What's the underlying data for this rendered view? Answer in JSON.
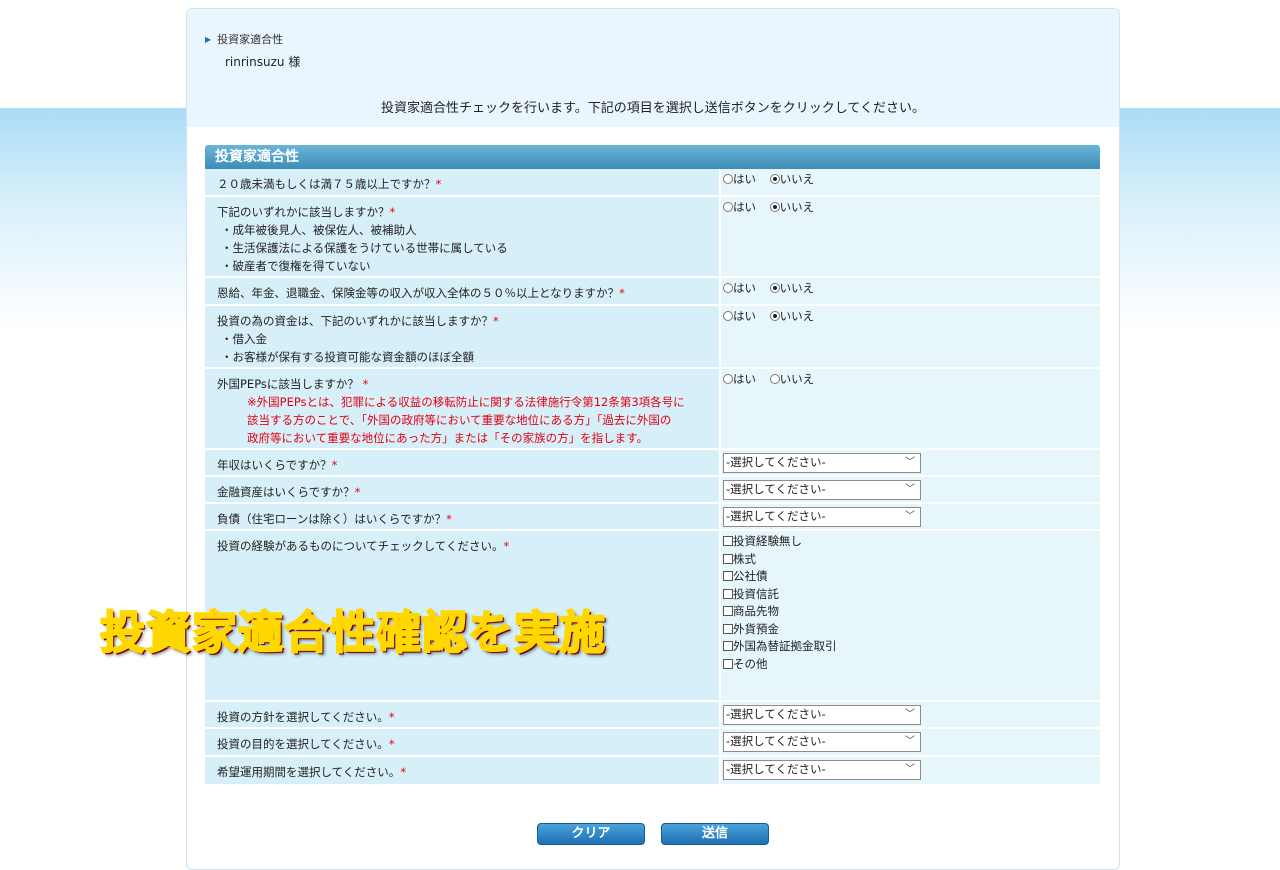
{
  "breadcrumb": "投資家適合性",
  "user": {
    "name": "rinrinsuzu",
    "suffix": "様"
  },
  "instruction": "投資家適合性チェックを行います。下記の項目を選択し送信ボタンをクリックしてください。",
  "form_title": "投資家適合性",
  "required_mark": "*",
  "radio_labels": {
    "yes": "はい",
    "no": "いいえ"
  },
  "q": {
    "age": {
      "label": "２０歳未満もしくは満７５歳以上ですか？",
      "selected": "いいえ"
    },
    "status": {
      "label": "下記のいずれかに該当しますか？",
      "items": [
        "・成年被後見人、被保佐人、被補助人",
        "・生活保護法による保護をうけている世帯に属している",
        "・破産者で復権を得ていない"
      ],
      "selected": "いいえ"
    },
    "pension": {
      "label": "恩給、年金、退職金、保険金等の収入が収入全体の５０％以上となりますか？",
      "selected": "いいえ"
    },
    "funds": {
      "label": "投資の為の資金は、下記のいずれかに該当しますか？",
      "items": [
        "・借入金",
        "・お客様が保有する投資可能な資金額のほぼ全額"
      ],
      "selected": "いいえ"
    },
    "peps": {
      "label": "外国PEPsに該当しますか？",
      "notes": [
        "※外国PEPsとは、犯罪による収益の移転防止に関する法律施行令第12条第3項各号に",
        "該当する方のことで、「外国の政府等において重要な地位にある方」「過去に外国の",
        "政府等において重要な地位にあった方」または「その家族の方」を指します。"
      ],
      "selected": ""
    },
    "income": {
      "label": "年収はいくらですか？",
      "value": "-選択してください-"
    },
    "assets": {
      "label": "金融資産はいくらですか？",
      "value": "-選択してください-"
    },
    "debt": {
      "label": "負債（住宅ローンは除く）はいくらですか？",
      "value": "-選択してください-"
    },
    "experience": {
      "label": "投資の経験があるものについてチェックしてください。",
      "options": [
        "投資経験無し",
        "株式",
        "公社債",
        "投資信託",
        "商品先物",
        "外貨預金",
        "外国為替証拠金取引",
        "その他"
      ]
    },
    "policy": {
      "label": "投資の方針を選択してください。",
      "value": "-選択してください-"
    },
    "purpose": {
      "label": "投資の目的を選択してください。",
      "value": "-選択してください-"
    },
    "period": {
      "label": "希望運用期間を選択してください。",
      "value": "-選択してください-"
    }
  },
  "buttons": {
    "clear": "クリア",
    "submit": "送信"
  },
  "overlay_text": "投資家適合性確認を実施",
  "colors": {
    "header_bar": "#3d8cb8",
    "question_bg": "#d6eff8",
    "answer_bg": "#e6f6fb",
    "required": "#e60012",
    "button": "#1e6fb3",
    "overlay": "#ff2a10"
  }
}
